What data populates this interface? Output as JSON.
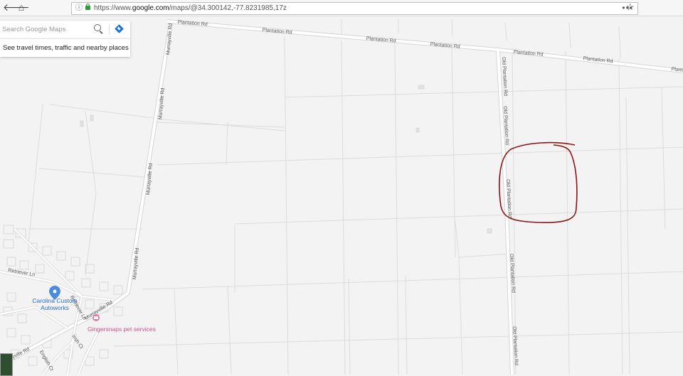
{
  "browser": {
    "url_prefix": "https://www.",
    "url_domain": "google.com",
    "url_path": "/maps/@34.300142,-77.8231985,17z",
    "info_icon": "info-icon",
    "lock_icon": "lock-icon",
    "menu_dots": "•••",
    "star_icon": "☆",
    "back_icon": "🡐",
    "home_icon": "⌂"
  },
  "search": {
    "placeholder": "Search Google Maps",
    "travel_text": "See travel times, traffic and nearby places"
  },
  "roads": {
    "plantation": [
      "Plantation Rd",
      "Plantation Rd",
      "Plantation Rd",
      "Plantation Rd",
      "Plantation Rd",
      "Plantation Rd",
      "Plantation"
    ],
    "murrayville": [
      "Murrayville Rd",
      "Murrayville Rd",
      "Murrayville Rd",
      "Murrayville Rd",
      "Murrayville Rd"
    ],
    "old_plantation": [
      "Old Plantation Rd",
      "Old Plantation Rd",
      "Old Plantation Rd",
      "Old Plantation Rd",
      "Old Plantation Rd"
    ],
    "retriever_ln": "Retriever Ln",
    "retriever_ln2": "Retriever Ln",
    "murrayville_sw": "Murrayville Rd",
    "english_ct": "English Ct",
    "irish_ct": "Irish Ct"
  },
  "pois": {
    "carolina": [
      "Carolina Custom",
      "Autoworks"
    ],
    "gingersnaps": "Gingersnaps pet services"
  },
  "colors": {
    "map_bg": "#f3f3f4",
    "road": "#ffffff",
    "road_casing": "#d4d4d4",
    "parcel": "#dcdcdc",
    "annotation": "#8b1414",
    "poi_blue": "#2a6cc9",
    "poi_pink": "#d04f8c"
  }
}
